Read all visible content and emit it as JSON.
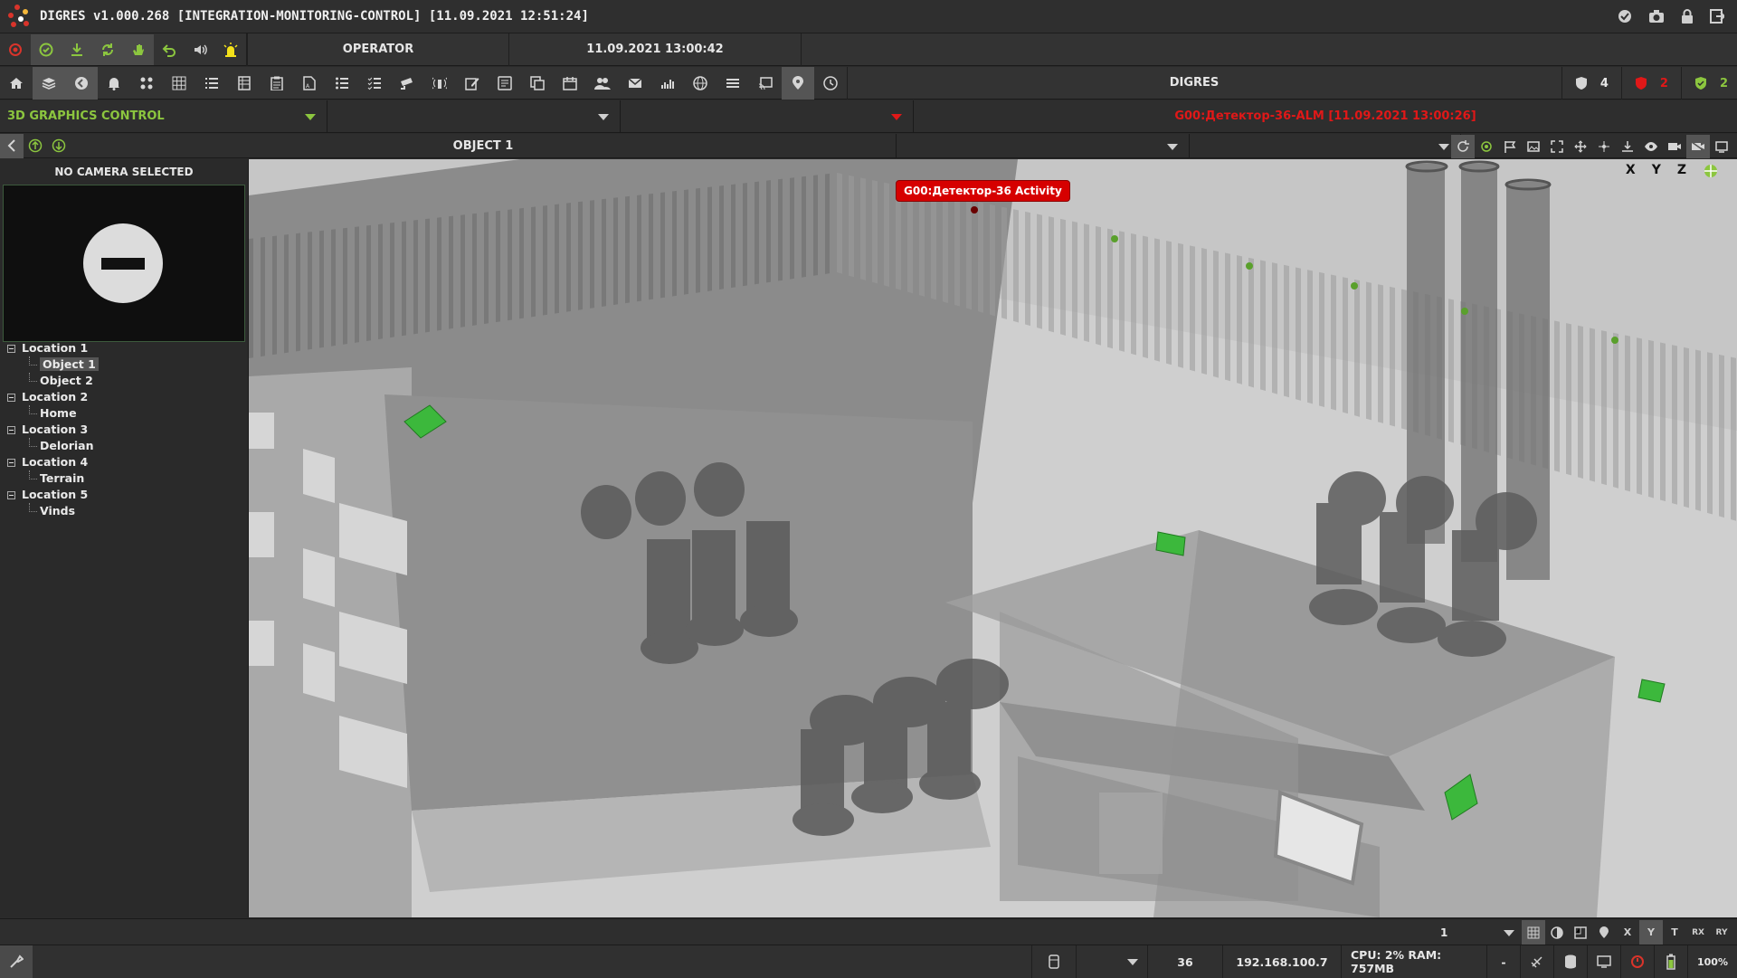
{
  "titlebar": {
    "title": "DIGRES v1.000.268 [INTEGRATION-MONITORING-CONTROL] [11.09.2021 12:51:24]"
  },
  "row2": {
    "role": "OPERATOR",
    "datetime": "11.09.2021 13:00:42"
  },
  "row3": {
    "center_title": "DIGRES",
    "counts": {
      "total": "4",
      "alarm": "2",
      "ok": "2"
    }
  },
  "row4": {
    "mode": "3D GRAPHICS CONTROL",
    "alarm_text": "G00:Детектор-36-ALM [11.09.2021 13:00:26]"
  },
  "row5": {
    "object": "OBJECT 1"
  },
  "sidebar": {
    "camera_title": "NO CAMERA SELECTED",
    "tree": [
      {
        "label": "Location 1",
        "children": [
          "Object 1",
          "Object 2"
        ]
      },
      {
        "label": "Location 2",
        "children": [
          "Home"
        ]
      },
      {
        "label": "Location 3",
        "children": [
          "Delorian"
        ]
      },
      {
        "label": "Location 4",
        "children": [
          "Terrain"
        ]
      },
      {
        "label": "Location 5",
        "children": [
          "Vinds"
        ]
      }
    ]
  },
  "viewport": {
    "alarm_badge": "G00:Детектор-36 Activity",
    "axes": [
      "X",
      "Y",
      "Z"
    ]
  },
  "statusbar": {
    "zoom_value": "1",
    "right_labels": [
      "X",
      "Y",
      "T",
      "RX",
      "RY"
    ]
  },
  "bottombar": {
    "dash": "-",
    "count": "36",
    "ip": "192.168.100.7",
    "cpu_ram": "CPU: 2% RAM: 757MB",
    "zoom": "100%"
  },
  "colors": {
    "alarm_red": "#d60000",
    "accent_green": "#8cc63f",
    "alarm_text": "#e01818",
    "camera_green": "#3cb83c"
  }
}
